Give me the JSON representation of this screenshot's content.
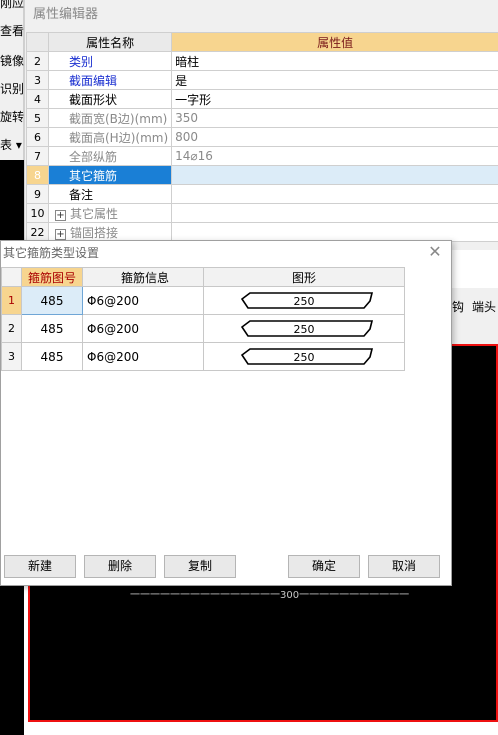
{
  "left_strip": {
    "items": [
      "刚应月",
      "查看钢",
      "镜像",
      "识别",
      "旋转点",
      "表 ▾"
    ]
  },
  "property_editor": {
    "title": "属性编辑器",
    "headers": {
      "name": "属性名称",
      "value": "属性值"
    },
    "rows": [
      {
        "num": "2",
        "name": "类别",
        "value": "暗柱",
        "style": "blue"
      },
      {
        "num": "3",
        "name": "截面编辑",
        "value": "是",
        "style": "blue"
      },
      {
        "num": "4",
        "name": "截面形状",
        "value": "一字形",
        "style": ""
      },
      {
        "num": "5",
        "name": "截面宽(B边)(mm)",
        "value": "350",
        "style": "gray"
      },
      {
        "num": "6",
        "name": "截面高(H边)(mm)",
        "value": "800",
        "style": "gray"
      },
      {
        "num": "7",
        "name": "全部纵筋",
        "value": "14⌀16",
        "style": "gray"
      },
      {
        "num": "8",
        "name": "其它箍筋",
        "value": "",
        "style": "selected"
      },
      {
        "num": "9",
        "name": "备注",
        "value": "",
        "style": ""
      },
      {
        "num": "10",
        "name": "其它属性",
        "value": "",
        "style": "group"
      },
      {
        "num": "22",
        "name": "锚固搭接",
        "value": "",
        "style": "group"
      }
    ]
  },
  "right_tools": {
    "items": [
      "钩",
      "端头"
    ]
  },
  "canvas": {
    "text": "一一一一一一一一一一一一一一一300一一一一一一一一一一一"
  },
  "dialog": {
    "title": "其它箍筋类型设置",
    "headers": {
      "no": "箍筋图号",
      "info": "箍筋信息",
      "shape": "图形"
    },
    "rows": [
      {
        "row": "1",
        "no": "485",
        "info": "Φ6@200",
        "shape_value": "250"
      },
      {
        "row": "2",
        "no": "485",
        "info": "Φ6@200",
        "shape_value": "250"
      },
      {
        "row": "3",
        "no": "485",
        "info": "Φ6@200",
        "shape_value": "250"
      }
    ],
    "buttons": {
      "new": "新建",
      "delete": "删除",
      "copy": "复制",
      "ok": "确定",
      "cancel": "取消"
    }
  }
}
